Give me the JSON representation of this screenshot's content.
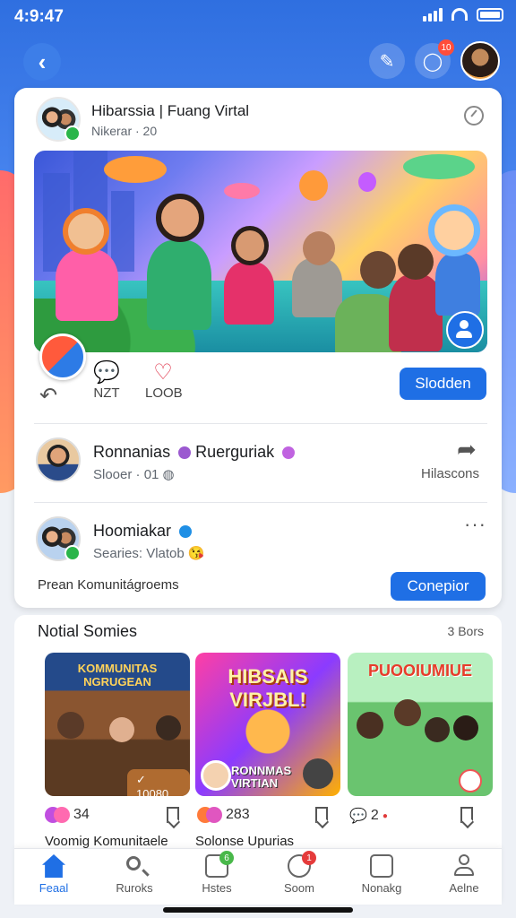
{
  "status_bar": {
    "time": "4:9:47"
  },
  "header": {
    "notification_count": "10"
  },
  "post": {
    "title": "Hibarssia | Fuang Virtal",
    "subtitle": "Nikerar · 20",
    "actions": [
      {
        "label": "NZT",
        "icon": "comment-icon"
      },
      {
        "label": "LOOB",
        "icon": "heart-icon"
      }
    ],
    "follow_button": "Slodden"
  },
  "members": [
    {
      "name": "Ronnanias",
      "name2": "Ruerguriak",
      "meta": "Slooer · 01",
      "side_label": "Hilascons",
      "badge_color": "#9b59d0"
    },
    {
      "name": "Hoomiakar",
      "meta": "Searies: Vlatob",
      "badge_color": "#1f8fe5"
    }
  ],
  "community": {
    "text": "Prean Komunitágroems",
    "button": "Conepior"
  },
  "section": {
    "title": "Notial Somies",
    "count": "3 Bors",
    "items": [
      {
        "thumb_title": "KOMMUNITAS NGRUGEAN",
        "pill": "✓ 10080",
        "reactions": "34",
        "caption": "Voomig Komunitaele"
      },
      {
        "thumb_title": "HIBSAIS VIRJBL!",
        "thumb_sub": "RONNMAS VIRTIAN",
        "reactions": "283",
        "caption": "Solonse Upurias"
      },
      {
        "thumb_title": "PUOOIUMIUE",
        "reactions": "2",
        "caption": ""
      }
    ]
  },
  "tabs": [
    {
      "label": "Feaal",
      "active": true
    },
    {
      "label": "Ruroks"
    },
    {
      "label": "Hstes",
      "badge": "6"
    },
    {
      "label": "Soom",
      "badge": "1"
    },
    {
      "label": "Nonakg"
    },
    {
      "label": "Aelne"
    }
  ]
}
